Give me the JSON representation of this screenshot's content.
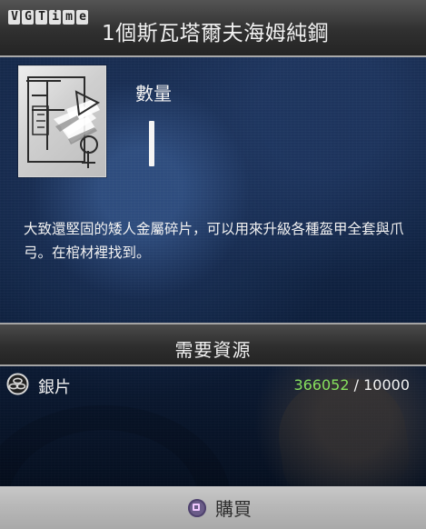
{
  "watermark": {
    "letters": [
      "V",
      "G",
      "T",
      "i",
      "m",
      "e"
    ]
  },
  "header": {
    "title": "1個斯瓦塔爾夫海姆純鋼"
  },
  "item": {
    "image_icon": "steel-ingot-image",
    "quantity_label": "數量",
    "description": "大致還堅固的矮人金屬碎片，可以用來升級各種盔甲全套與爪弓。在棺材裡找到。"
  },
  "requirements": {
    "title": "需要資源",
    "resource": {
      "icon": "silver-pieces-icon",
      "name": "銀片",
      "current": "366052",
      "separator": "/",
      "required": "10000"
    }
  },
  "action": {
    "button_icon": "square-button-icon",
    "buy_label": "購買"
  },
  "colors": {
    "title_bar": "#303030",
    "accent_green": "#86e05e",
    "background_blue": "#112445",
    "action_bar": "#b8b8b8"
  }
}
